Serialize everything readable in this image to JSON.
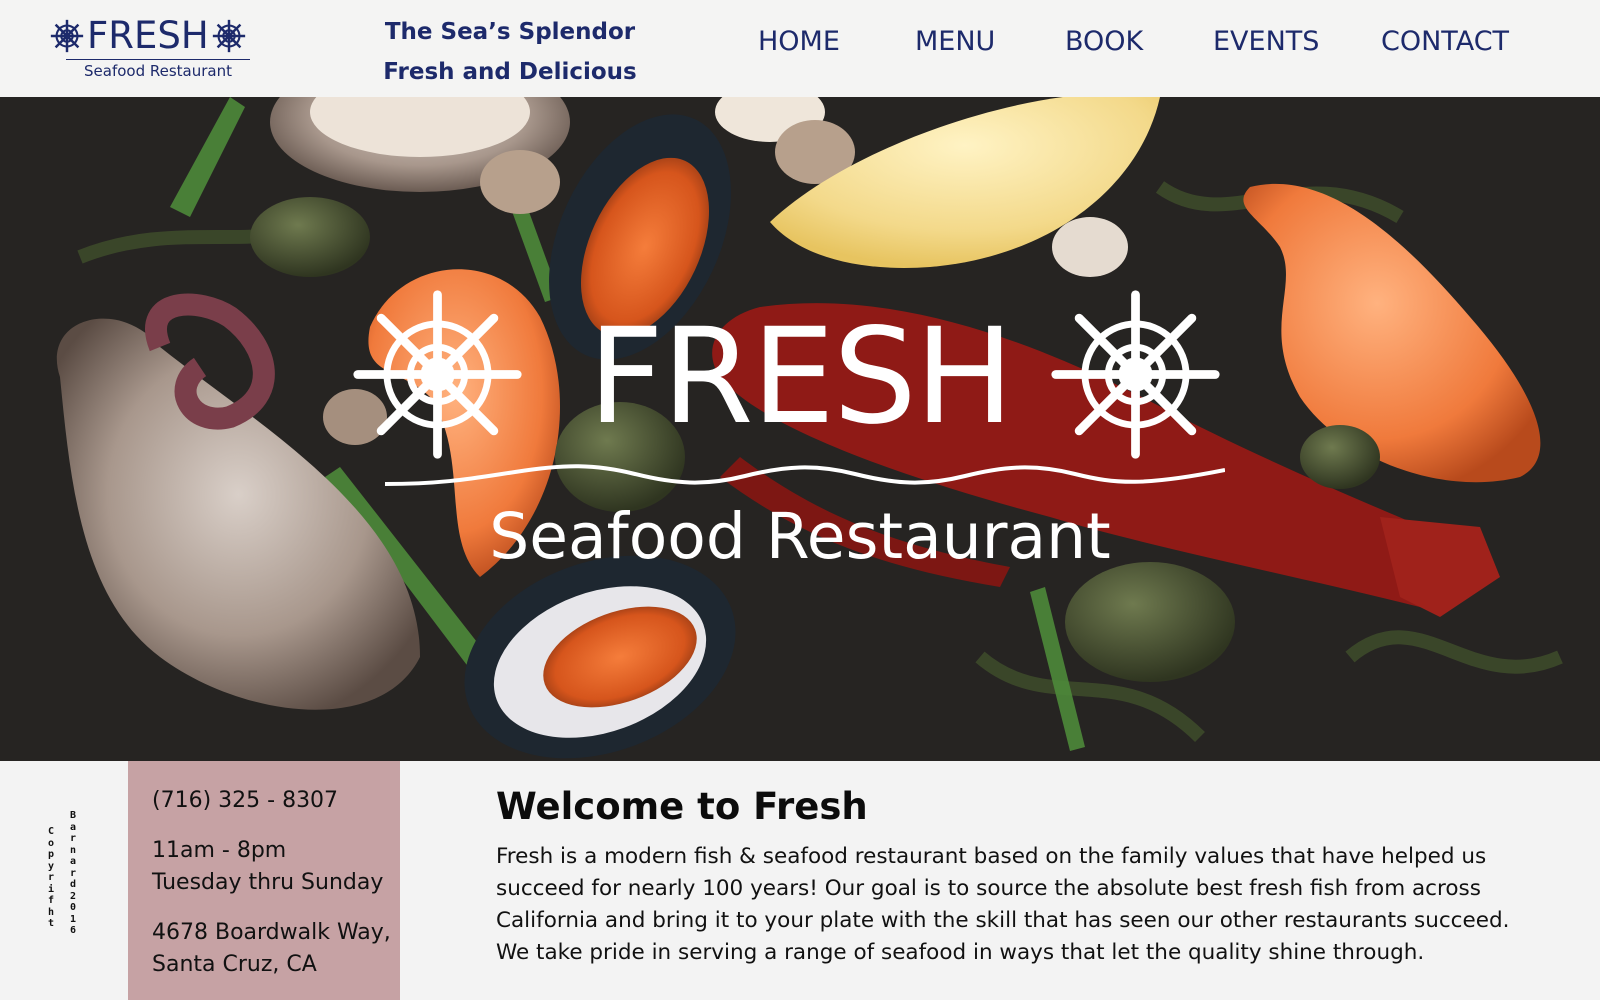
{
  "header": {
    "logo_word": "FRESH",
    "logo_sub": "Seafood Restaurant",
    "tagline_line1": "The Sea’s Splendor",
    "tagline_line2": "Fresh and Delicious"
  },
  "nav": {
    "items": [
      {
        "label": "HOME"
      },
      {
        "label": "MENU"
      },
      {
        "label": "BOOK"
      },
      {
        "label": "EVENTS"
      },
      {
        "label": "CONTACT"
      }
    ]
  },
  "hero": {
    "title": "FRESH",
    "subtitle": "Seafood Restaurant"
  },
  "copyright": {
    "col1": "Copyrifht",
    "col2": "Barnard2016"
  },
  "info": {
    "phone": "(716) 325 - 8307",
    "hours_time": "11am - 8pm",
    "hours_days": "Tuesday thru Sunday",
    "address_line1": "4678 Boardwalk Way,",
    "address_line2": "Santa Cruz, CA"
  },
  "welcome": {
    "title": "Welcome to Fresh",
    "body": "Fresh is a modern fish & seafood restaurant based on the family values that have helped us succeed for nearly 100 years!  Our goal is to source the absolute best fresh fish from across California and bring it to your plate with the skill that has seen our other restaurants succeed. We take pride in serving a range of seafood in ways that let the quality shine through."
  },
  "colors": {
    "brand_navy": "#1d2a6b",
    "info_box_pink": "#c6a2a4",
    "page_bg": "#f3f3f3"
  },
  "icons": {
    "logo_wheel": "ship-wheel-icon"
  }
}
